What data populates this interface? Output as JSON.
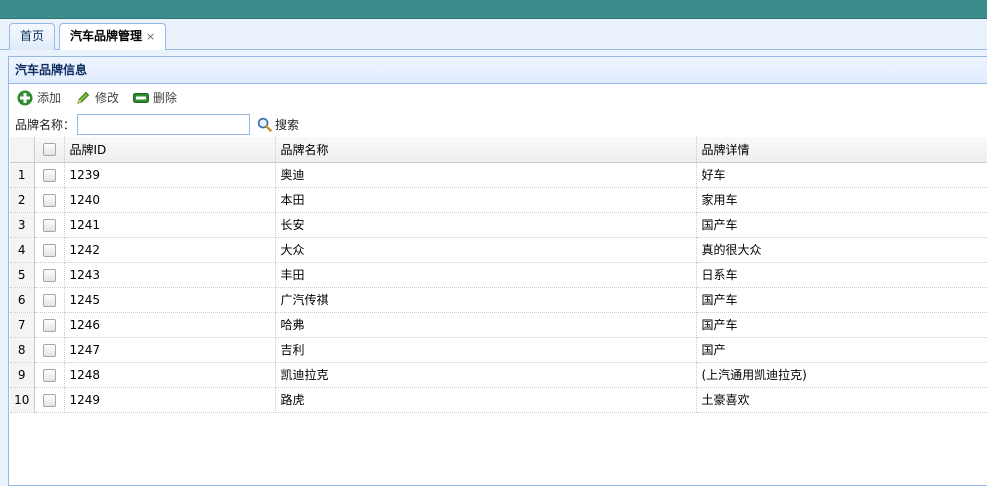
{
  "colors": {
    "topbar": "#3a8d8c",
    "border": "#95b8e7",
    "header_bg": "#e0ecff"
  },
  "tabs": [
    {
      "label": "首页",
      "active": false
    },
    {
      "label": "汽车品牌管理",
      "active": true,
      "close": "×"
    }
  ],
  "panel": {
    "title": "汽车品牌信息"
  },
  "toolbar": {
    "add_label": "添加",
    "edit_label": "修改",
    "delete_label": "删除"
  },
  "search": {
    "label": "品牌名称：",
    "value": "",
    "button_label": "搜索"
  },
  "table": {
    "columns": [
      "品牌ID",
      "品牌名称",
      "品牌详情"
    ],
    "rows": [
      {
        "num": "1",
        "id": "1239",
        "name": "奥迪",
        "detail": "好车"
      },
      {
        "num": "2",
        "id": "1240",
        "name": "本田",
        "detail": "家用车"
      },
      {
        "num": "3",
        "id": "1241",
        "name": "长安",
        "detail": "国产车"
      },
      {
        "num": "4",
        "id": "1242",
        "name": "大众",
        "detail": "真的很大众"
      },
      {
        "num": "5",
        "id": "1243",
        "name": "丰田",
        "detail": "日系车"
      },
      {
        "num": "6",
        "id": "1245",
        "name": "广汽传祺",
        "detail": "国产车"
      },
      {
        "num": "7",
        "id": "1246",
        "name": "哈弗",
        "detail": "国产车"
      },
      {
        "num": "8",
        "id": "1247",
        "name": "吉利",
        "detail": "国产"
      },
      {
        "num": "9",
        "id": "1248",
        "name": "凯迪拉克",
        "detail": "(上汽通用凯迪拉克)"
      },
      {
        "num": "10",
        "id": "1249",
        "name": "路虎",
        "detail": "土豪喜欢"
      }
    ]
  }
}
